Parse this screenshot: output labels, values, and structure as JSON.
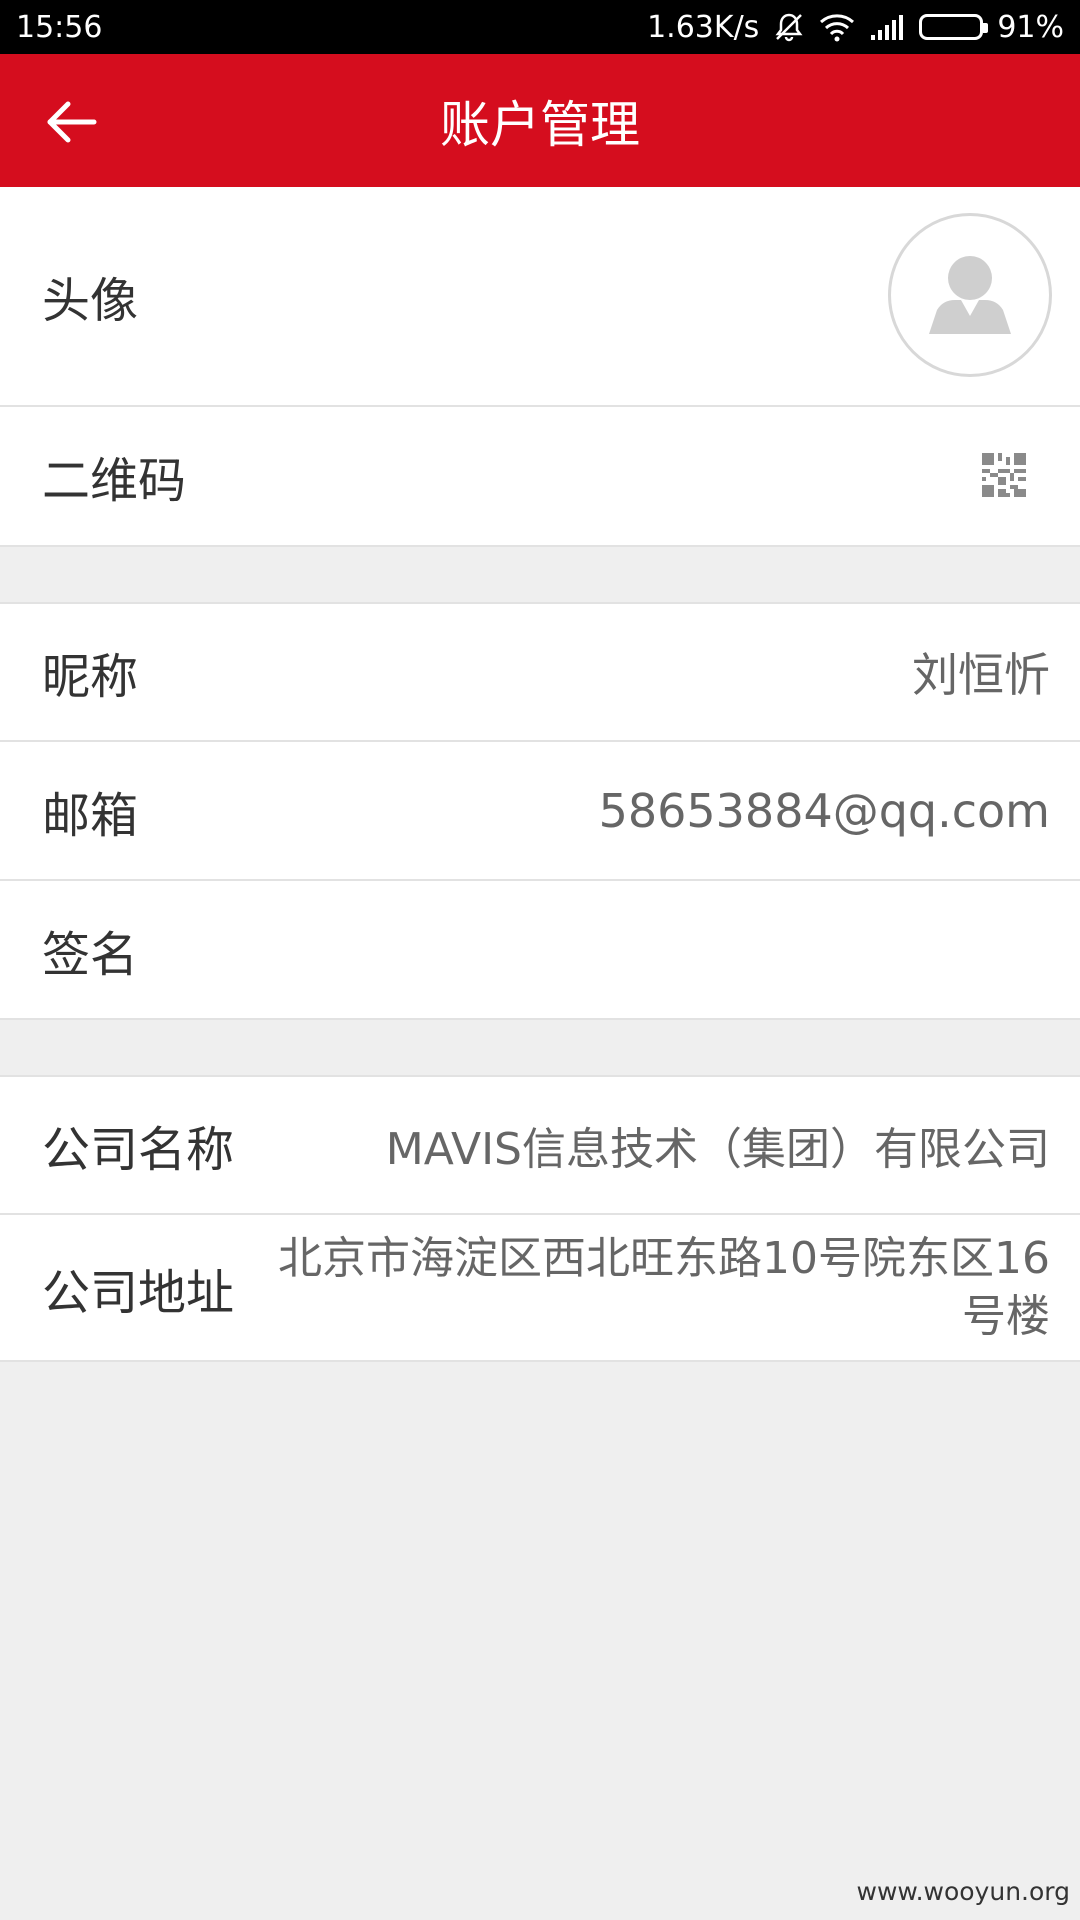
{
  "status_bar": {
    "time": "15:56",
    "net_speed": "1.63K/s",
    "battery_percent": "91%",
    "icons": [
      "mute-icon",
      "wifi-icon",
      "signal-icon",
      "battery-icon"
    ]
  },
  "app_bar": {
    "title": "账户管理",
    "back_icon": "arrow-left-icon",
    "background_color": "#d50d1e"
  },
  "rows": {
    "avatar": {
      "label": "头像",
      "icon": "default-avatar-icon"
    },
    "qrcode": {
      "label": "二维码",
      "icon": "qr-code-icon"
    },
    "nickname": {
      "label": "昵称",
      "value": "刘恒忻"
    },
    "email": {
      "label": "邮箱",
      "value": "58653884@qq.com"
    },
    "signature": {
      "label": "签名",
      "value": ""
    },
    "company_name": {
      "label": "公司名称",
      "value": "MAVIS信息技术（集团）有限公司"
    },
    "company_address": {
      "label": "公司地址",
      "value": "北京市海淀区西北旺东路10号院东区16号楼"
    }
  },
  "watermark": "www.wooyun.org"
}
